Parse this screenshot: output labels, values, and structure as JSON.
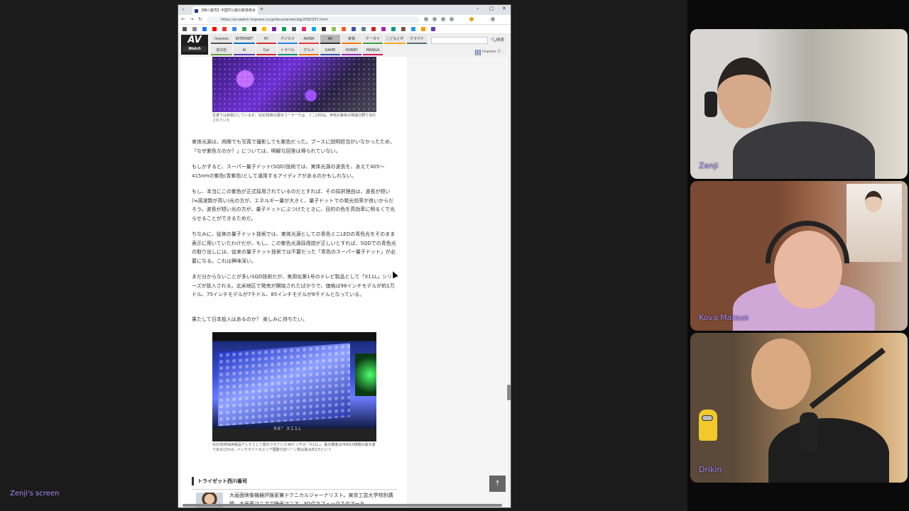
{
  "share": {
    "label": "Zenji's screen"
  },
  "browser": {
    "tab_title": "【西川善司】中国TCL製の新技術...",
    "url": "https://av.watch.impress.co.jp/docs/series/zlg/2092257.html"
  },
  "site": {
    "logo_main": "AV",
    "logo_sub": "Watch",
    "nav_row1": [
      "Impress Watch",
      "INTERNET",
      "PC",
      "デジカメ",
      "AKIBA",
      "AV",
      "家電",
      "ケータイ",
      "こどもとIT",
      "クラウド"
    ],
    "nav_row2": [
      "窓の杜",
      "AI",
      "Car",
      "トラベル",
      "グルメ",
      "GAME",
      "HOBBY",
      "MANGA"
    ],
    "active_nav": "AV",
    "search_label": "検索",
    "group_label": "Impress グ..."
  },
  "article": {
    "caption1": "写真では目視びしているが、SQD技術の展示コーナーでは、ミニLEDは、甲色の紫色の明滅分野で点灯されていた",
    "paragraphs": [
      "実体光源は、肉眼でも写真で撮影しても紫色だった。ブースに説明担当がいなかったため、「なぜ紫色なのか？」については、明解な回答は得られていない。",
      "もしかすると、スーパー量子ドット(SQD)技術では、実体光源の波長を、あえて405～415nmの紫色(青紫色)として運用するアイディアがあるのかもしれない。",
      "もし、本当にこの紫色が正式採用されているのだとすれば、その採択理由は、波長が短い(≒周波数が高い)光の方が、エネルギー量が大きく、量子ドットでの発光効率が良いからだろう。波長が短い光の方が、量子ドットにぶつけたときに、目的の色を高効率に明るくで光らせることができるためだ。",
      "ちなみに、従来の量子ドット技術では、実体光源としての青色ミニLEDの青色光をそのまま表示に用いていたわけだが、もし、この紫色光源採用説が正しいとすれば、SQDでの青色光の取り出しには、従来の量子ドット技術では不要だった「青色のスーパー量子ドット」が必要になる。これは興味深い。",
      "まだ分からないことが多いSQD技術だが、実用化第1号のテレビ製品として「X11L」シリーズが投入される。北米地区で発売が開始されたばかりで、価格は98インチモデルが約1万ドル、75インチモデルが7千ドル、85インチモデルが8千ドルとなっている。",
      "果たして日本投入はあるのか？ 楽しみに待ちたい。"
    ],
    "tv_label": "98\" X11L",
    "caption2": "SQD技術採用製品テレビとして展示されていた98インチの「X11L」。最大輝度はHDR10規格の最大値である1万nit。バックライトのエリア駆動分割ゾーン数は最大約2万という",
    "author_heading": "トライゼット西川善司",
    "author_bio": "大画面映像機器評論家兼テクニカルジャーナリスト。東京工芸大学特別講師。大画面マニアで映画マニア。3Dグラフィックスのアーキ"
  },
  "participants": [
    {
      "name": "Zenji"
    },
    {
      "name": "Kova Matsuo"
    },
    {
      "name": "Drikin"
    }
  ],
  "colors": {
    "accent": "#a78bfa",
    "background": "#0a0a0a"
  }
}
